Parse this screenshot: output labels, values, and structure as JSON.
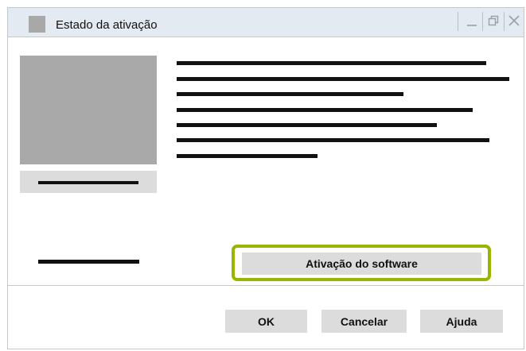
{
  "window": {
    "title": "Estado da ativação",
    "controls": {
      "minimize_icon": "minimize-icon",
      "restore_icon": "restore-icon",
      "close_icon": "close-icon"
    }
  },
  "main": {
    "activation_button_label": "Ativação do software",
    "highlight_color": "#9ab500"
  },
  "footer": {
    "ok_label": "OK",
    "cancel_label": "Cancelar",
    "help_label": "Ajuda"
  }
}
